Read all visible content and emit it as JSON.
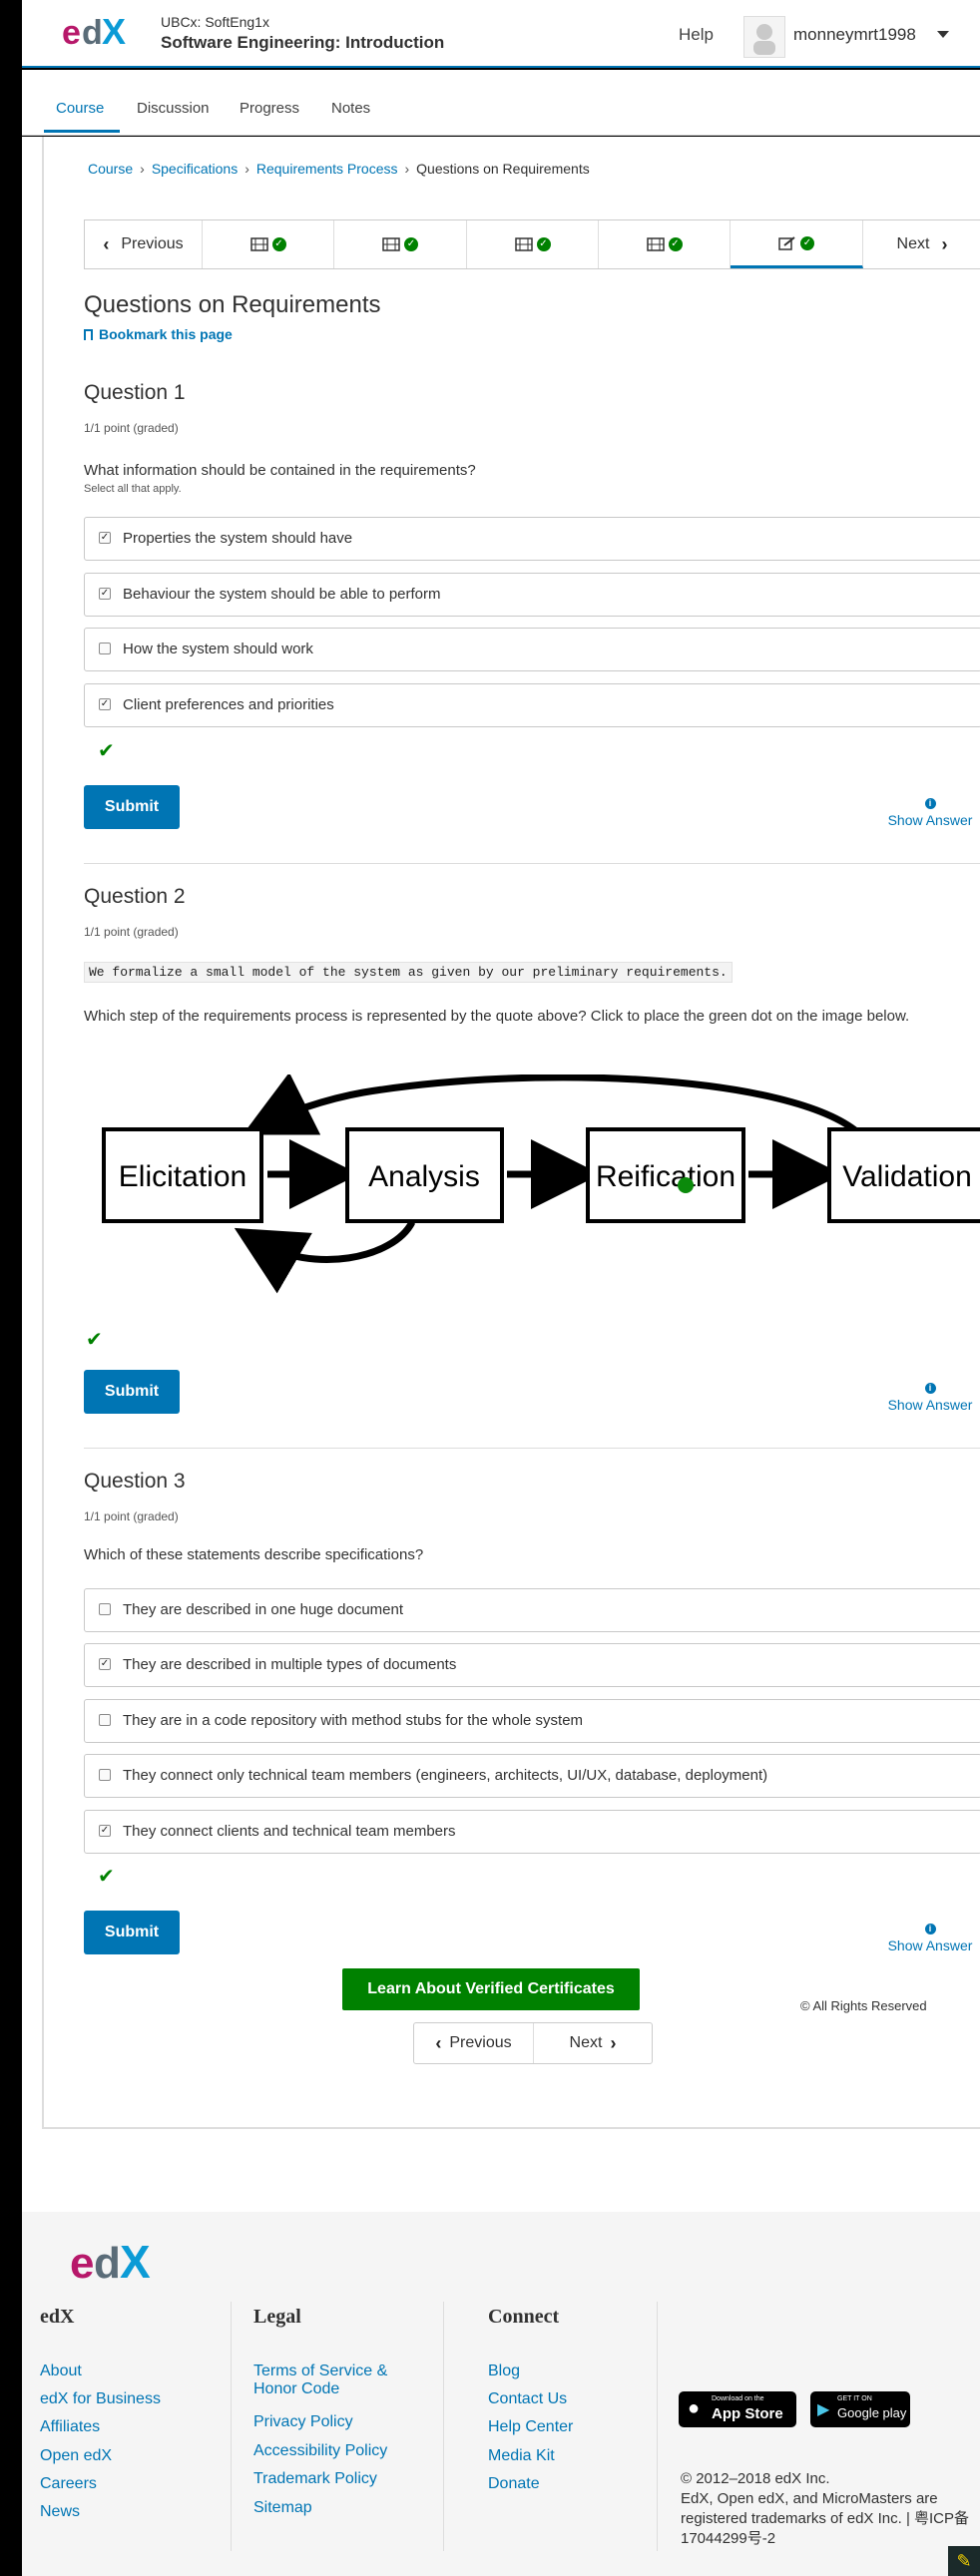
{
  "header": {
    "logo_text": "edX",
    "course_org": "UBCx: SoftEng1x",
    "course_name": "Software Engineering: Introduction",
    "help": "Help",
    "username": "monneymrt1998"
  },
  "tabs": [
    {
      "label": "Course",
      "active": true
    },
    {
      "label": "Discussion"
    },
    {
      "label": "Progress"
    },
    {
      "label": "Notes"
    }
  ],
  "breadcrumb": [
    "Course",
    "Specifications",
    "Requirements Process",
    "Questions on Requirements"
  ],
  "sequence_nav": {
    "previous": "Previous",
    "next": "Next",
    "units": [
      {
        "icon": "video-icon",
        "complete": true
      },
      {
        "icon": "video-icon",
        "complete": true
      },
      {
        "icon": "video-icon",
        "complete": true
      },
      {
        "icon": "video-icon",
        "complete": true
      },
      {
        "icon": "problem-icon",
        "complete": true,
        "active": true
      }
    ]
  },
  "unit": {
    "title": "Questions on Requirements",
    "bookmark": "Bookmark this page"
  },
  "questions": [
    {
      "title": "Question 1",
      "points": "1/1 point (graded)",
      "prompt": "What information should be contained in the requirements?",
      "hint": "Select all that apply.",
      "choices": [
        {
          "label": "Properties the system should have",
          "checked": true
        },
        {
          "label": "Behaviour the system should be able to perform",
          "checked": true
        },
        {
          "label": "How the system should work",
          "checked": false
        },
        {
          "label": "Client preferences and priorities",
          "checked": true
        }
      ],
      "submit": "Submit",
      "show_answer": "Show Answer"
    },
    {
      "title": "Question 2",
      "points": "1/1 point (graded)",
      "quote": "We formalize a small model of the system as given by our preliminary requirements.",
      "prompt": "Which step of the requirements process is represented by the quote above? Click to place the green dot on the image below.",
      "diagram": {
        "steps": [
          "Elicitation",
          "Analysis",
          "Reification",
          "Validation"
        ],
        "selected_step": "Reification"
      },
      "submit": "Submit",
      "show_answer": "Show Answer"
    },
    {
      "title": "Question 3",
      "points": "1/1 point (graded)",
      "prompt": "Which of these statements describe specifications?",
      "choices": [
        {
          "label": "They are described in one huge document",
          "checked": false
        },
        {
          "label": "They are described in multiple types of documents",
          "checked": true
        },
        {
          "label": "They are in a code repository with method stubs for the whole system",
          "checked": false
        },
        {
          "label": "They connect only technical team members (engineers, architects, UI/UX, database, deployment)",
          "checked": false
        },
        {
          "label": "They connect clients and technical team members",
          "checked": true
        }
      ],
      "submit": "Submit",
      "show_answer": "Show Answer"
    }
  ],
  "bottom_nav": {
    "previous": "Previous",
    "next": "Next"
  },
  "verified_button": "Learn About Verified Certificates",
  "rights": "© All Rights Reserved",
  "footer": {
    "logo_text": "edX",
    "columns": [
      {
        "heading": "edX",
        "links": [
          "About",
          "edX for Business",
          "Affiliates",
          "Open edX",
          "Careers",
          "News"
        ]
      },
      {
        "heading": "Legal",
        "links": [
          "Terms of Service & Honor Code",
          "Privacy Policy",
          "Accessibility Policy",
          "Trademark Policy",
          "Sitemap"
        ]
      },
      {
        "heading": "Connect",
        "links": [
          "Blog",
          "Contact Us",
          "Help Center",
          "Media Kit",
          "Donate"
        ]
      }
    ],
    "app_store": {
      "small": "Download on the",
      "big": "App Store"
    },
    "google_play": {
      "small": "GET IT ON",
      "big": "Google play"
    },
    "copyright": "© 2012–2018 edX Inc.",
    "trademark": "EdX, Open edX, and MicroMasters are registered trademarks of edX Inc. | 粤ICP备17044299号-2"
  },
  "colors": {
    "link": "#0075b4",
    "success": "#008100",
    "button": "#0075b4"
  }
}
